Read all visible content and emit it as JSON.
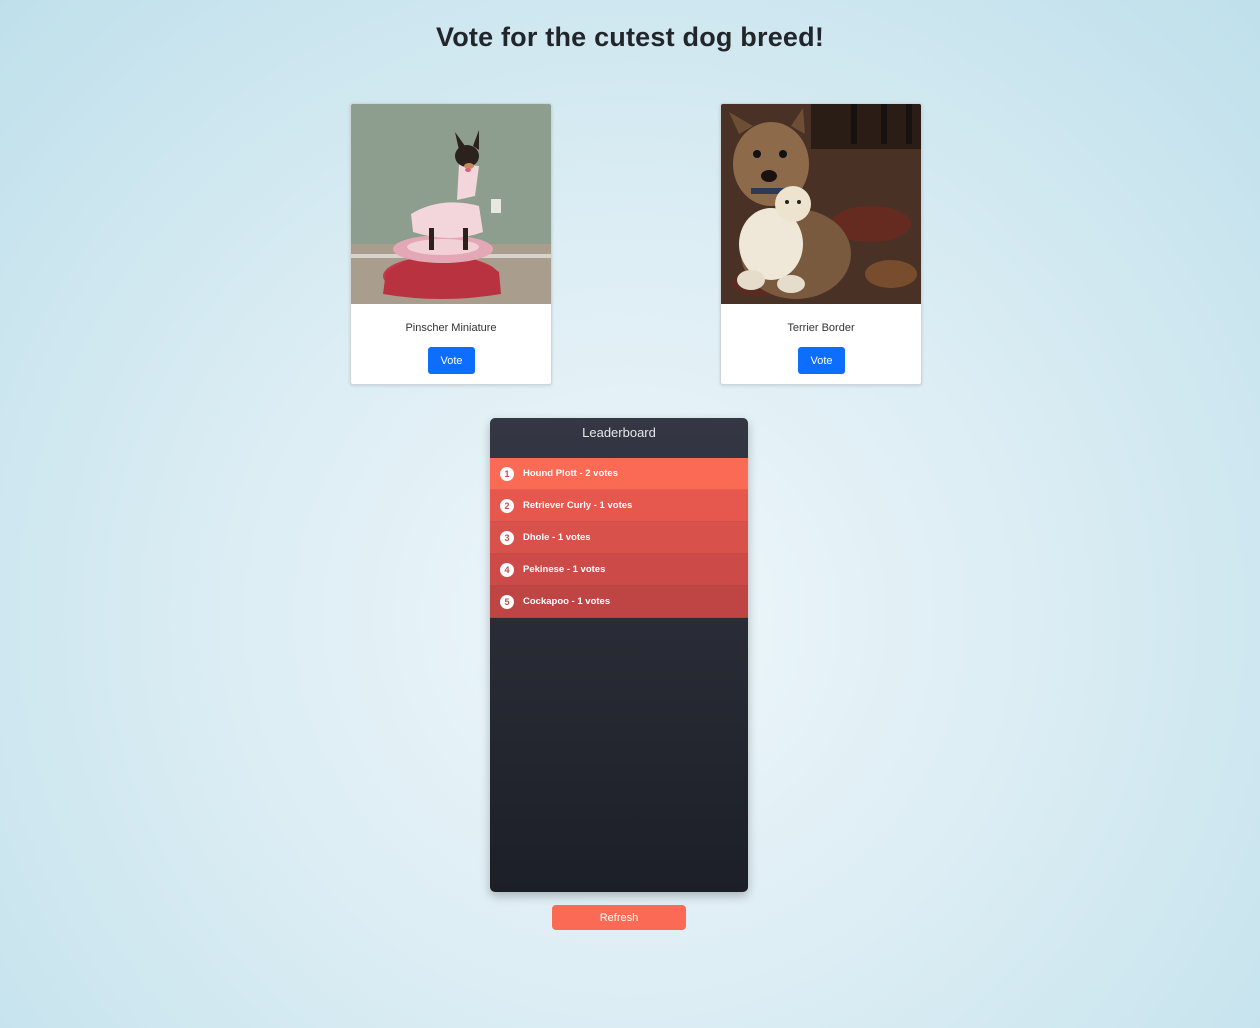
{
  "page": {
    "title": "Vote for the cutest dog breed!"
  },
  "cards": [
    {
      "name": "Pinscher Miniature",
      "vote_label": "Vote"
    },
    {
      "name": "Terrier Border",
      "vote_label": "Vote"
    }
  ],
  "leaderboard": {
    "title": "Leaderboard",
    "entries": [
      {
        "rank": "1",
        "text": "Hound Plott - 2 votes",
        "color": "#fb6a54"
      },
      {
        "rank": "2",
        "text": "Retriever Curly - 1 votes",
        "color": "#e6574d"
      },
      {
        "rank": "3",
        "text": "Dhole - 1 votes",
        "color": "#d9514b"
      },
      {
        "rank": "4",
        "text": "Pekinese - 1 votes",
        "color": "#cc4b48"
      },
      {
        "rank": "5",
        "text": "Cockapoo - 1 votes",
        "color": "#bf4545"
      }
    ]
  },
  "refresh_label": "Refresh",
  "colors": {
    "vote_button": "#0d6efd",
    "refresh_button": "#fb6a54"
  }
}
